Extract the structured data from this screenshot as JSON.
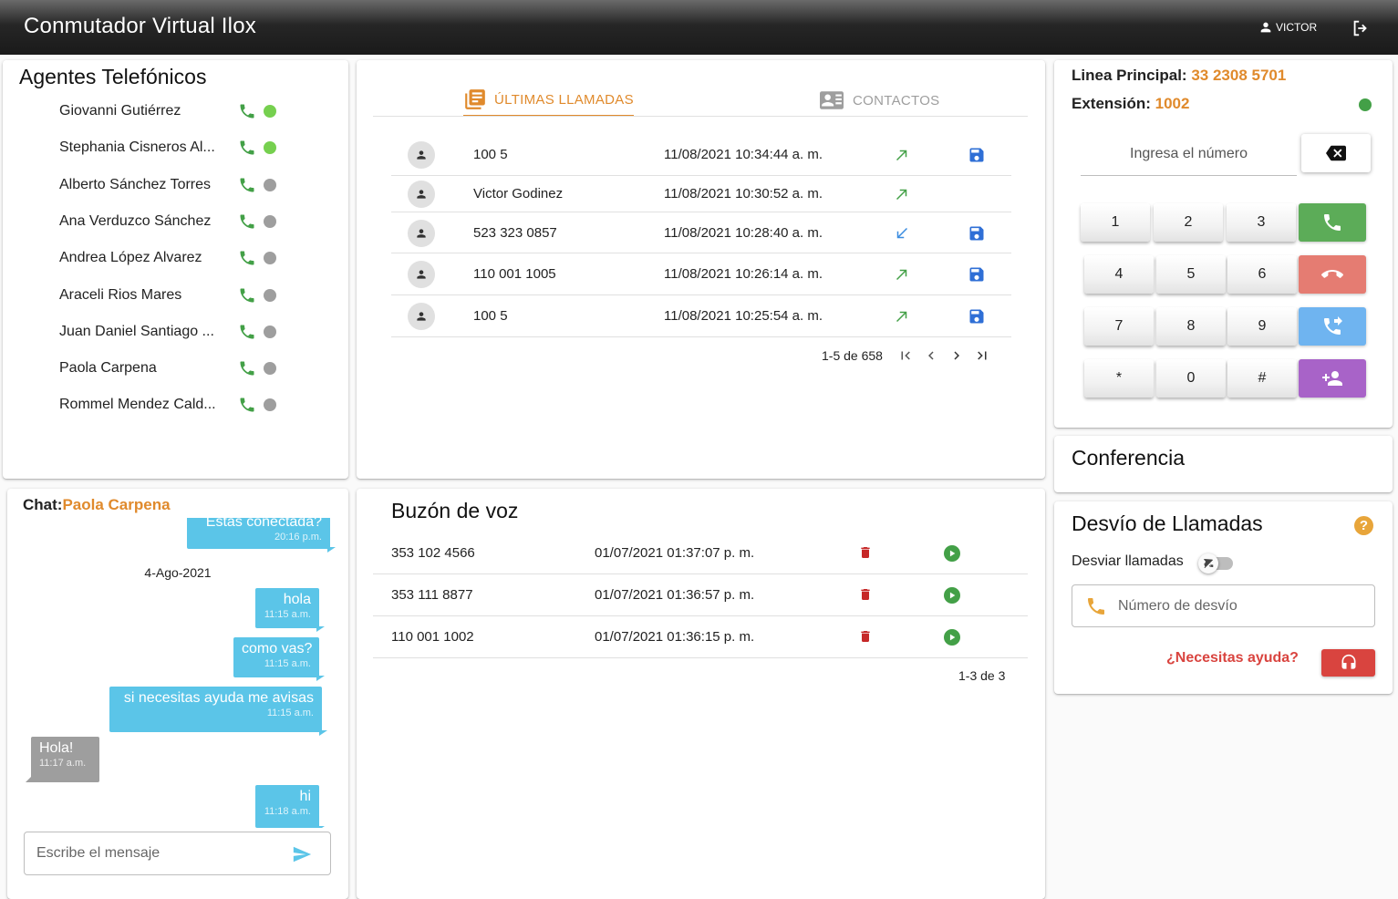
{
  "app": {
    "title": "Conmutador Virtual Ilox",
    "user": "VICTOR"
  },
  "agents": {
    "title": "Agentes Telefónicos",
    "items": [
      {
        "name": "Giovanni Gutiérrez",
        "status_color": "#76d04f"
      },
      {
        "name": "Stephania Cisneros Al...",
        "status_color": "#76d04f"
      },
      {
        "name": "Alberto Sánchez Torres",
        "status_color": "#9e9e9e"
      },
      {
        "name": "Ana Verduzco Sánchez",
        "status_color": "#9e9e9e"
      },
      {
        "name": "Andrea López Alvarez",
        "status_color": "#9e9e9e"
      },
      {
        "name": "Araceli Rios Mares",
        "status_color": "#9e9e9e"
      },
      {
        "name": "Juan Daniel Santiago ...",
        "status_color": "#9e9e9e"
      },
      {
        "name": "Paola Carpena",
        "status_color": "#9e9e9e"
      },
      {
        "name": "Rommel Mendez Cald...",
        "status_color": "#9e9e9e"
      }
    ]
  },
  "calls": {
    "tabs": [
      {
        "label": "ÚLTIMAS LLAMADAS",
        "icon": "list-icon",
        "active": true
      },
      {
        "label": "CONTACTOS",
        "icon": "contacts-icon",
        "active": false
      }
    ],
    "rows": [
      {
        "number": "100 5",
        "datetime": "11/08/2021 10:34:44 a. m.",
        "direction": "outgoing",
        "saveable": true
      },
      {
        "number": "Victor Godinez",
        "datetime": "11/08/2021 10:30:52 a. m.",
        "direction": "outgoing",
        "saveable": false
      },
      {
        "number": "523 323 0857",
        "datetime": "11/08/2021 10:28:40 a. m.",
        "direction": "incoming",
        "saveable": true
      },
      {
        "number": "110 001 1005",
        "datetime": "11/08/2021 10:26:14 a. m.",
        "direction": "outgoing",
        "saveable": true
      },
      {
        "number": "100 5",
        "datetime": "11/08/2021 10:25:54 a. m.",
        "direction": "outgoing",
        "saveable": true
      }
    ],
    "pagination": "1-5 de 658"
  },
  "dialer": {
    "line_label": "Linea Principal:",
    "line_value": "33 2308 5701",
    "ext_label": "Extensión:",
    "ext_value": "1002",
    "status_color": "#43a047",
    "input_placeholder": "Ingresa el número",
    "keys": [
      [
        "1",
        "2",
        "3"
      ],
      [
        "4",
        "5",
        "6"
      ],
      [
        "7",
        "8",
        "9"
      ],
      [
        "*",
        "0",
        "#"
      ]
    ],
    "actions": [
      {
        "name": "call",
        "color": "#5cac58"
      },
      {
        "name": "hangup",
        "color": "#e57c72"
      },
      {
        "name": "transfer",
        "color": "#6fb4f0"
      },
      {
        "name": "add-participant",
        "color": "#a863c8"
      }
    ]
  },
  "conference": {
    "title": "Conferencia"
  },
  "forwarding": {
    "title": "Desvío de Llamadas",
    "toggle_label": "Desviar llamadas",
    "input_placeholder": "Número de desvío",
    "help_text": "¿Necesitas ayuda?"
  },
  "chat": {
    "label": "Chat:",
    "contact": "Paola Carpena",
    "messages": [
      {
        "text": "Estas conectada?",
        "time": "20:16 p.m."
      },
      {
        "date": "4-Ago-2021"
      },
      {
        "text": "hola",
        "time": "11:15 a.m."
      },
      {
        "text": "como vas?",
        "time": "11:15 a.m."
      },
      {
        "text": "si necesitas ayuda me avisas",
        "time": "11:15 a.m."
      },
      {
        "text": "Hola!",
        "time": "11:17 a.m."
      },
      {
        "text": "hi",
        "time": "11:18 a.m."
      }
    ],
    "input_placeholder": "Escribe el mensaje"
  },
  "voicemail": {
    "title": "Buzón de voz",
    "rows": [
      {
        "number": "353 102 4566",
        "datetime": "01/07/2021 01:37:07 p. m."
      },
      {
        "number": "353 111 8877",
        "datetime": "01/07/2021 01:36:57 p. m."
      },
      {
        "number": "110 001 1002",
        "datetime": "01/07/2021 01:36:15 p. m."
      }
    ],
    "pagination": "1-3 de 3"
  }
}
